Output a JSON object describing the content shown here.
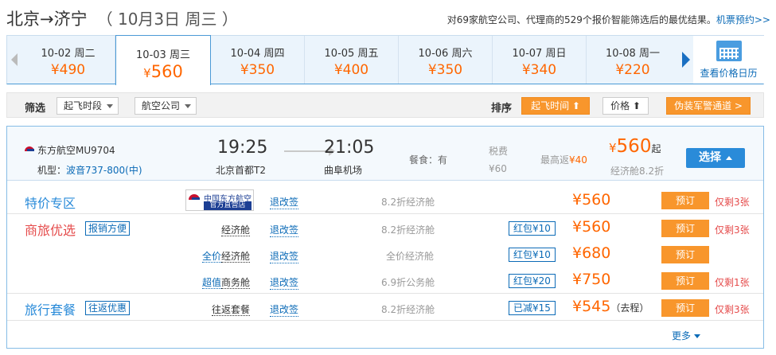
{
  "header": {
    "route": "北京→济宁",
    "date": "（ 10月3日 周三 ）",
    "summary": "对69家航空公司、代理商的529个报价智能筛选后的最优结果。",
    "summary_link": "机票预约>>"
  },
  "dates": [
    {
      "date": "10-02 周二",
      "price": "¥490",
      "selected": false
    },
    {
      "date": "10-03 周三",
      "price_symbol": "¥",
      "price_value": "560",
      "selected": true
    },
    {
      "date": "10-04 周四",
      "price": "¥350",
      "selected": false
    },
    {
      "date": "10-05 周五",
      "price": "¥400",
      "selected": false
    },
    {
      "date": "10-06 周六",
      "price": "¥350",
      "selected": false
    },
    {
      "date": "10-07 周日",
      "price": "¥340",
      "selected": false
    },
    {
      "date": "10-08 周一",
      "price": "¥220",
      "selected": false
    }
  ],
  "calendar_label": "查看价格日历",
  "filters": {
    "filter_label": "筛选",
    "takeoff_time": "起飞时段",
    "airline": "航空公司",
    "sort_label": "排序",
    "sort_takeoff": "起飞时间 ⬆",
    "sort_price": "价格 ⬆",
    "fraud_channel": "伪装军警通道 >"
  },
  "flight": {
    "airline": "东方航空MU9704",
    "model_label": "机型：",
    "model": "波音737-800(中)",
    "dep_time": "19:25",
    "dep_airport": "北京首都T2",
    "arr_time": "21:05",
    "arr_airport": "曲阜机场",
    "meal": "餐食：有",
    "tax_label": "税费",
    "tax_value": "¥60",
    "max_rebate_label": "最高返",
    "max_rebate_value": "¥40",
    "low_symbol": "¥",
    "low_value": "560",
    "low_suffix": "起",
    "discount": "经济舱8.2折",
    "choose_label": "选择"
  },
  "rows": {
    "r1": {
      "tag": "特价专区",
      "store_line1": "中国东方航空",
      "store_line2": "官方直营店",
      "rule": "退改签",
      "fare": "8.2折经济舱",
      "price": "¥560",
      "book": "预订",
      "left": "仅剩3张"
    },
    "r2": {
      "tag": "商旅优选",
      "badge": "报销方便",
      "cabin": "经济舱",
      "rule": "退改签",
      "fare": "8.2折经济舱",
      "packet": "红包¥10",
      "price": "¥560",
      "book": "预订",
      "left": "仅剩3张"
    },
    "r3": {
      "cabin_prefix": "全价",
      "cabin": "经济舱",
      "rule": "退改签",
      "fare": "全价经济舱",
      "packet": "红包¥10",
      "price": "¥680",
      "book": "预订"
    },
    "r4": {
      "cabin_prefix": "超值",
      "cabin": "商务舱",
      "rule": "退改签",
      "fare": "6.9折公务舱",
      "packet": "红包¥20",
      "price": "¥750",
      "book": "预订",
      "left": "仅剩1张"
    },
    "r5": {
      "tag": "旅行套餐",
      "badge": "往返优惠",
      "cabin": "往返套餐",
      "rule": "退改签",
      "fare": "8.2折经济舱",
      "packet": "已减¥15",
      "price": "¥545",
      "price_note": "（去程）",
      "book": "预订",
      "left": "仅剩3张"
    }
  },
  "more_label": "更多"
}
